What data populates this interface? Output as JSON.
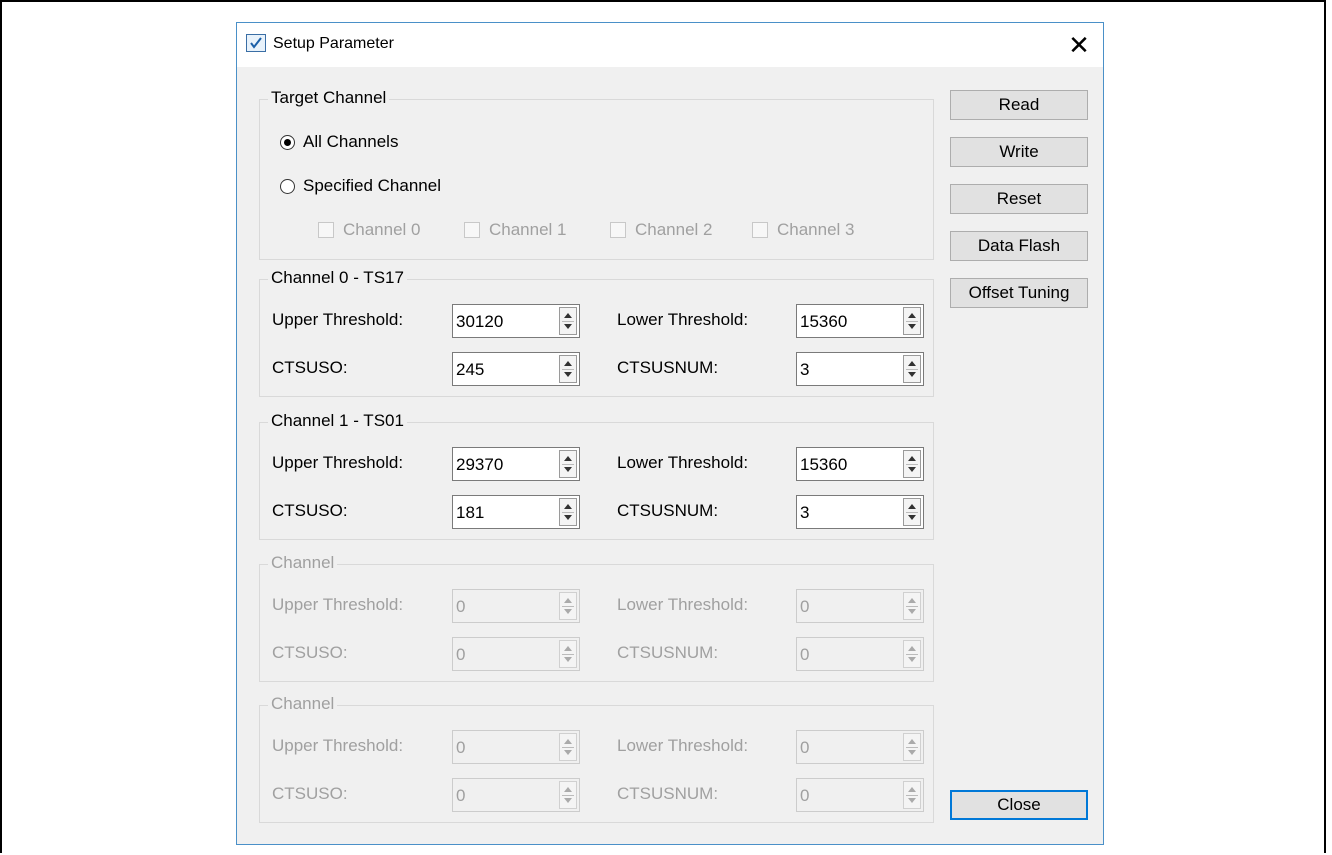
{
  "window": {
    "title": "Setup Parameter",
    "close_glyph": "✕",
    "icon": "checkbox-app-icon"
  },
  "target_channel": {
    "legend": "Target Channel",
    "radio_all": {
      "label": "All Channels",
      "selected": true
    },
    "radio_specified": {
      "label": "Specified Channel",
      "selected": false
    },
    "checkboxes": [
      "Channel 0",
      "Channel 1",
      "Channel 2",
      "Channel 3"
    ]
  },
  "channels": [
    {
      "legend": "Channel 0 - TS17",
      "enabled": true,
      "upper_label": "Upper Threshold:",
      "upper_value": "30120",
      "lower_label": "Lower Threshold:",
      "lower_value": "15360",
      "ctsuso_label": "CTSUSO:",
      "ctsuso_value": "245",
      "ctsusnum_label": "CTSUSNUM:",
      "ctsusnum_value": "3"
    },
    {
      "legend": "Channel 1 - TS01",
      "enabled": true,
      "upper_label": "Upper Threshold:",
      "upper_value": "29370",
      "lower_label": "Lower Threshold:",
      "lower_value": "15360",
      "ctsuso_label": "CTSUSO:",
      "ctsuso_value": "181",
      "ctsusnum_label": "CTSUSNUM:",
      "ctsusnum_value": "3"
    },
    {
      "legend": "Channel",
      "enabled": false,
      "upper_label": "Upper Threshold:",
      "upper_value": "0",
      "lower_label": "Lower Threshold:",
      "lower_value": "0",
      "ctsuso_label": "CTSUSO:",
      "ctsuso_value": "0",
      "ctsusnum_label": "CTSUSNUM:",
      "ctsusnum_value": "0"
    },
    {
      "legend": "Channel",
      "enabled": false,
      "upper_label": "Upper Threshold:",
      "upper_value": "0",
      "lower_label": "Lower Threshold:",
      "lower_value": "0",
      "ctsuso_label": "CTSUSO:",
      "ctsuso_value": "0",
      "ctsusnum_label": "CTSUSNUM:",
      "ctsusnum_value": "0"
    }
  ],
  "buttons": {
    "read": "Read",
    "write": "Write",
    "reset": "Reset",
    "data_flash": "Data Flash",
    "offset_tuning": "Offset Tuning",
    "close": "Close"
  },
  "colors": {
    "dialog_bg": "#f0f0f0",
    "accent": "#0078d7",
    "disabled_text": "#a0a0a0"
  }
}
